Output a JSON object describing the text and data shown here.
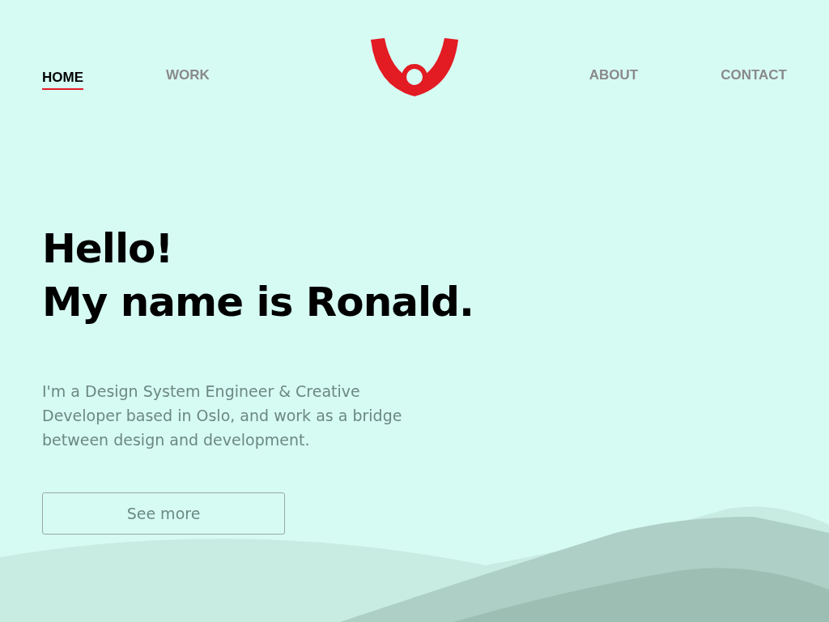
{
  "nav": {
    "left": [
      {
        "label": "HOME",
        "selected": true
      },
      {
        "label": "WORK",
        "selected": false
      }
    ],
    "right": [
      {
        "label": "ABOUT",
        "selected": false
      },
      {
        "label": "CONTACT",
        "selected": false
      }
    ]
  },
  "hero": {
    "heading": [
      "Hello!",
      "My name is Ronald."
    ],
    "intro": "I'm a Design System Engineer & Creative Developer based in Oslo, and work as a bridge between design and development.",
    "button": "See more"
  }
}
